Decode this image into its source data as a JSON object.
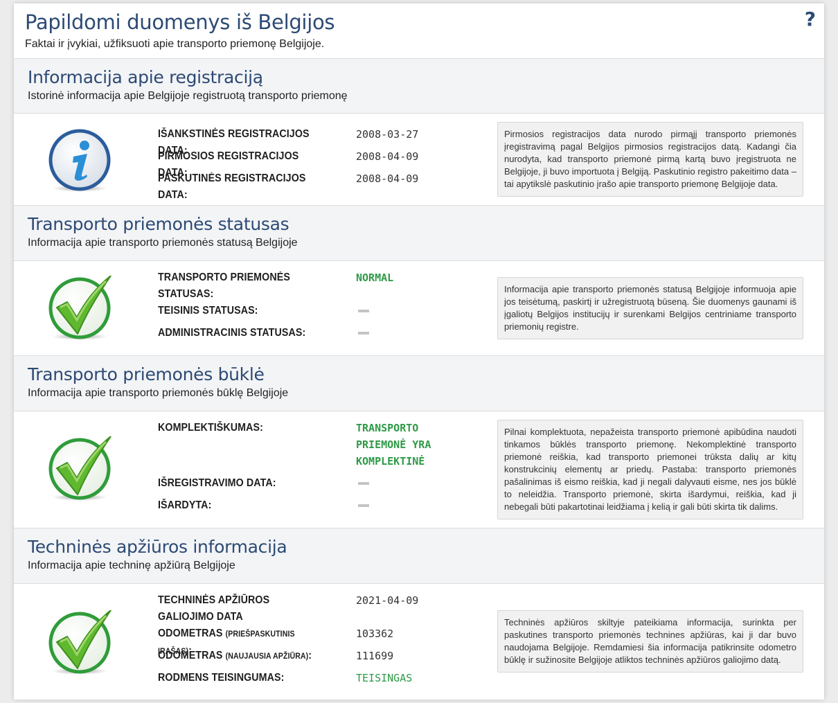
{
  "page": {
    "title": "Papildomi duomenys iš Belgijos",
    "subtitle": "Faktai ir įvykiai, užfiksuoti apie transporto priemonę Belgijoje.",
    "help_label": "?"
  },
  "registration": {
    "title": "Informacija apie registraciją",
    "subtitle": "Istorinė informacija apie Belgijoje registruotą transporto priemonę",
    "icon": "info-icon",
    "fields": [
      {
        "label": "IŠANKSTINĖS REGISTRACIJOS DATA:",
        "value": "2008-03-27"
      },
      {
        "label": "PIRMOSIOS REGISTRACIJOS DATA:",
        "value": "2008-04-09"
      },
      {
        "label": "PASKUTINĖS REGISTRACIJOS DATA:",
        "value": "2008-04-09"
      }
    ],
    "info": "Pirmosios registracijos data nurodo pirmąjį transporto priemonės įregistravimą pagal Belgijos pirmosios registracijos datą. Kadangi čia nurodyta, kad transporto priemonė pirmą kartą buvo įregistruota ne Belgijoje, ji buvo importuota į Belgiją. Paskutinio registro pakeitimo data – tai apytikslė paskutinio įrašo apie transporto priemonę Belgijoje data."
  },
  "status": {
    "title": "Transporto priemonės statusas",
    "subtitle": "Informacija apie transporto priemonės statusą Belgijoje",
    "icon": "checkmark-icon",
    "fields": [
      {
        "label": "TRANSPORTO PRIEMONĖS STATUSAS:",
        "value": "NORMAL"
      },
      {
        "label": "TEISINIS STATUSAS:",
        "value": ""
      },
      {
        "label": "ADMINISTRACINIS STATUSAS:",
        "value": ""
      }
    ],
    "info": "Informacija apie transporto priemonės statusą Belgijoje informuoja apie jos teisėtumą, paskirtį ir užregistruotą būseną. Šie duomenys gaunami iš įgaliotų Belgijos institucijų ir surenkami Belgijos centriniame transporto priemonių registre."
  },
  "condition": {
    "title": "Transporto priemonės būklė",
    "subtitle": "Informacija apie transporto priemonės būklę Belgijoje",
    "icon": "checkmark-icon",
    "fields": [
      {
        "label": "KOMPLEKTIŠKUMAS:",
        "value": "TRANSPORTO PRIEMONĖ YRA KOMPLEKTINĖ"
      },
      {
        "label": "IŠREGISTRAVIMO DATA:",
        "value": ""
      },
      {
        "label": "IŠARDYTA:",
        "value": ""
      }
    ],
    "info": "Pilnai komplektuota, nepažeista transporto priemonė apibūdina naudoti tinkamos būklės transporto priemonę. Nekomplektinė transporto priemonė reiškia, kad transporto priemonei trūksta dalių ar kitų konstrukcinių elementų ar priedų. Pastaba: transporto priemonės pašalinimas iš eismo reiškia, kad ji negali dalyvauti eisme, nes jos būklė to neleidžia. Transporto priemonė, skirta išardymui, reiškia, kad ji nebegali būti pakartotinai leidžiama į kelią ir gali būti skirta tik dalims."
  },
  "inspection": {
    "title": "Techninės apžiūros informacija",
    "subtitle": "Informacija apie techninę apžiūrą Belgijoje",
    "icon": "checkmark-icon",
    "fields": [
      {
        "label": "TECHNINĖS APŽIŪROS GALIOJIMO DATA",
        "value": "2021-04-09"
      },
      {
        "label": "ODOMETRAS",
        "label_note": "(PRIEŠPASKUTINIS ĮRAŠAS)",
        "label_end": ":",
        "value": "103362"
      },
      {
        "label": "ODOMETRAS",
        "label_note": "(NAUJAUSIA APŽIŪRA)",
        "label_end": ":",
        "value": "111699"
      },
      {
        "label": "RODMENS TEISINGUMAS:",
        "value": "TEISINGAS"
      }
    ],
    "info": "Techninės apžiūros skiltyje pateikiama informacija, surinkta per paskutines transporto priemonės technines apžiūras, kai ji dar buvo naudojama Belgijoje. Remdamiesi šia informacija patikrinsite odometro būklę ir sužinosite Belgijoje atliktos techninės apžiūros galiojimo datą."
  },
  "colors": {
    "title": "#2c4a74",
    "ok_green": "#2e9a47",
    "section_bg": "#f3f4f6",
    "info_bg": "#f1f1f1"
  }
}
